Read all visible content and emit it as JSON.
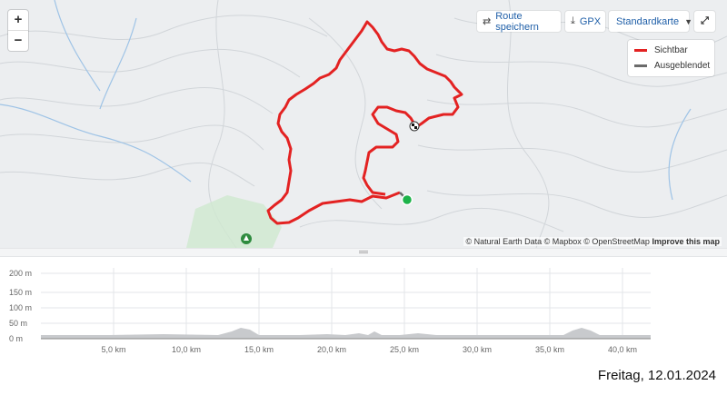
{
  "map": {
    "zoom_in": "+",
    "zoom_out": "−",
    "save_route_label": "Route speichern",
    "gpx_label": "GPX",
    "map_type_label": "Standardkarte",
    "legend": [
      {
        "label": "Sichtbar",
        "color": "#e32222"
      },
      {
        "label": "Ausgeblendet",
        "color": "#6b6b6b"
      }
    ],
    "attribution": "© Natural Earth Data © Mapbox © OpenStreetMap",
    "attribution_link": "Improve this map",
    "route_color": "#e32222",
    "start_color": "#1db34a"
  },
  "elevation": {
    "y_ticks": [
      "200 m",
      "150 m",
      "100 m",
      "50 m",
      "0 m"
    ],
    "x_ticks": [
      "5,0 km",
      "10,0 km",
      "15,0 km",
      "20,0 km",
      "25,0 km",
      "30,0 km",
      "35,0 km",
      "40,0 km"
    ]
  },
  "date": "Freitag, 12.01.2024"
}
